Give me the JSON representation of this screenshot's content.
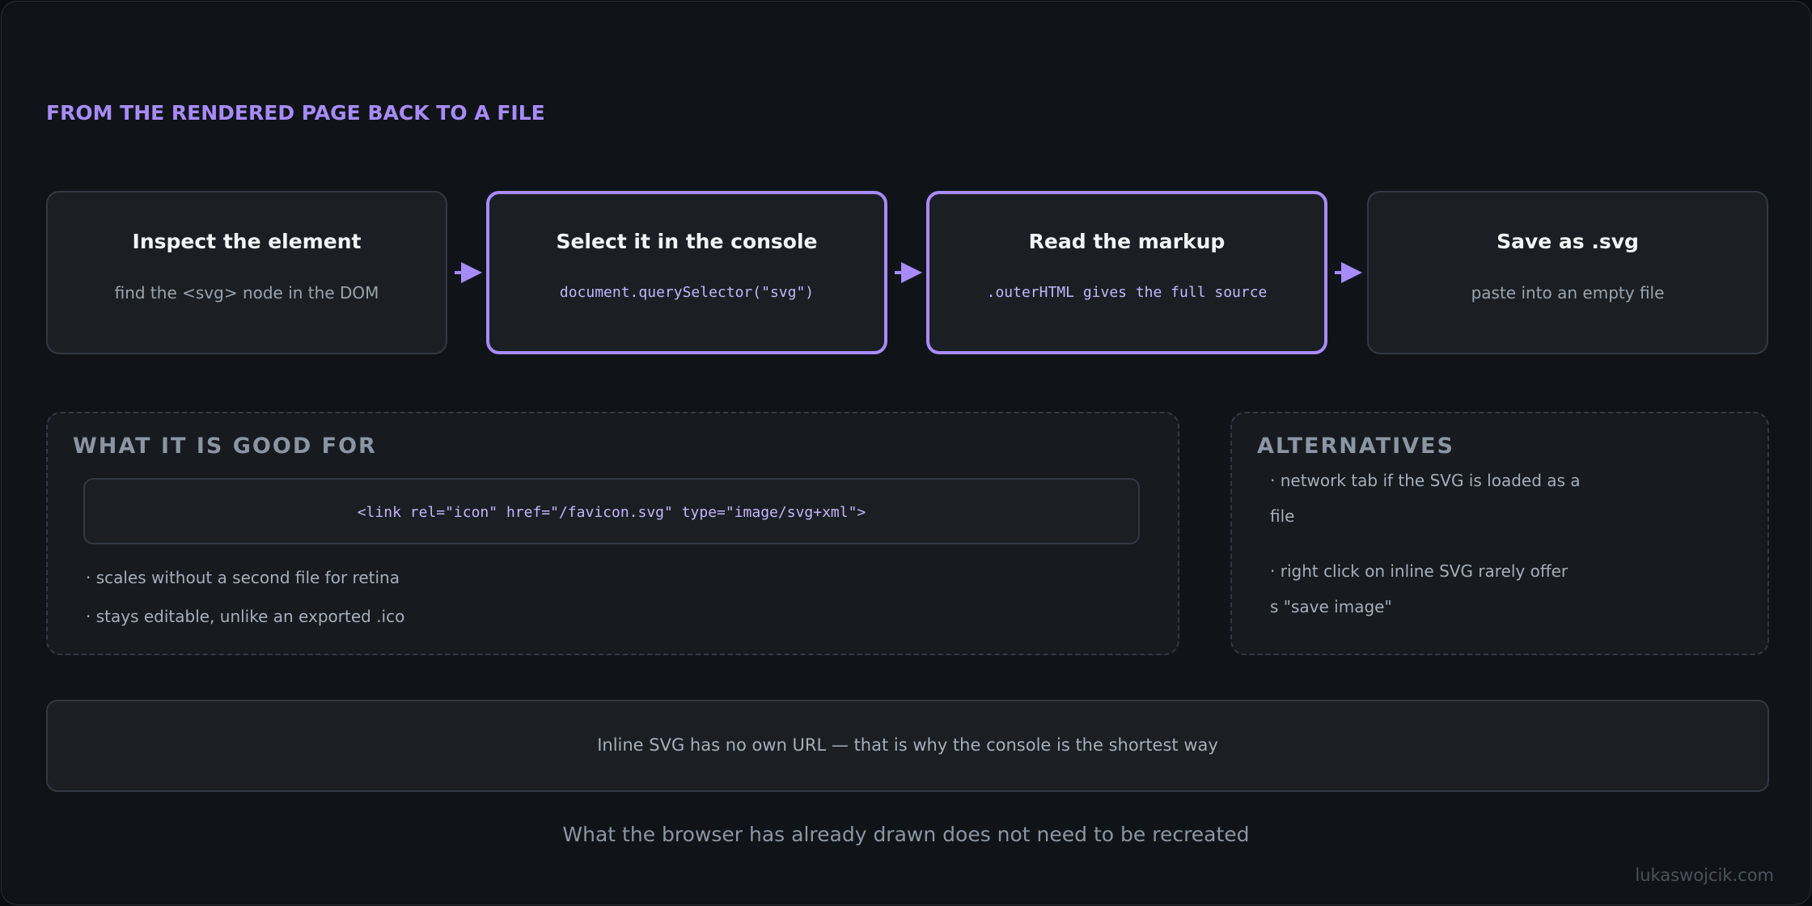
{
  "header": {
    "title": "FROM THE RENDERED PAGE BACK TO A FILE"
  },
  "steps": [
    {
      "title": "Inspect the element",
      "text": "find the <svg> node in the DOM",
      "highlighted": false
    },
    {
      "title": "Select it in the console",
      "code": "document.querySelector(\"svg\")",
      "highlighted": true
    },
    {
      "title": "Read the markup",
      "code": ".outerHTML gives the full source",
      "highlighted": true
    },
    {
      "title": "Save as .svg",
      "text": "paste into an empty file",
      "highlighted": false
    }
  ],
  "good_for": {
    "heading": "WHAT IT IS GOOD FOR",
    "code": "<link rel=\"icon\" href=\"/favicon.svg\" type=\"image/svg+xml\">",
    "bullets": [
      "· scales without a second file for retina",
      "· stays editable, unlike an exported .ico"
    ]
  },
  "alternatives": {
    "heading": "ALTERNATIVES",
    "lines": [
      "· network tab if the SVG is loaded as a",
      "file",
      "· right click on inline SVG rarely offer",
      "s \"save image\""
    ]
  },
  "note": "Inline SVG has no own URL — that is why the console is the shortest way",
  "tagline": "What the browser has already drawn does not need to be recreated",
  "credit": "lukaswojcik.com",
  "colors": {
    "accent": "#a78bfa",
    "background": "#101418",
    "card": "#1b1f24",
    "border": "#323844"
  }
}
